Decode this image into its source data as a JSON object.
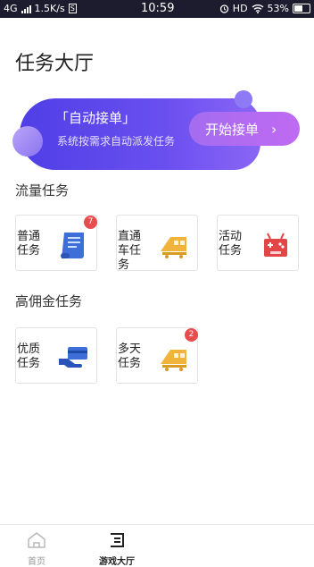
{
  "status_bar": {
    "network": "4G",
    "speed": "1.5K/s",
    "s_badge": "S",
    "time": "10:59",
    "hd": "HD",
    "battery": "53%"
  },
  "page": {
    "title": "任务大厅"
  },
  "banner": {
    "title": "「自动接单」",
    "subtitle": "系统按需求自动派发任务",
    "button_label": "开始接单",
    "chevron": "›"
  },
  "sections": [
    {
      "title": "流量任务",
      "cards": [
        {
          "label": "普通任务",
          "icon": "scroll-document-icon",
          "badge": "7"
        },
        {
          "label": "直通车任务",
          "icon": "train-icon",
          "badge": ""
        },
        {
          "label": "活动任务",
          "icon": "gamepad-icon",
          "badge": ""
        }
      ]
    },
    {
      "title": "高佣金任务",
      "cards": [
        {
          "label": "优质任务",
          "icon": "card-hand-icon",
          "badge": ""
        },
        {
          "label": "多天任务",
          "icon": "train-icon",
          "badge": "2"
        }
      ]
    }
  ],
  "tabbar": {
    "items": [
      {
        "label": "首页",
        "icon": "home-icon",
        "active": false
      },
      {
        "label": "游戏大厅",
        "icon": "hall-icon",
        "active": true
      }
    ]
  },
  "colors": {
    "accent": "#5b45eb",
    "button": "#b16cf1",
    "badge": "#e84c4c",
    "icon_blue": "#3e6fd8",
    "icon_gold": "#f0b43c",
    "icon_red": "#e24646"
  }
}
